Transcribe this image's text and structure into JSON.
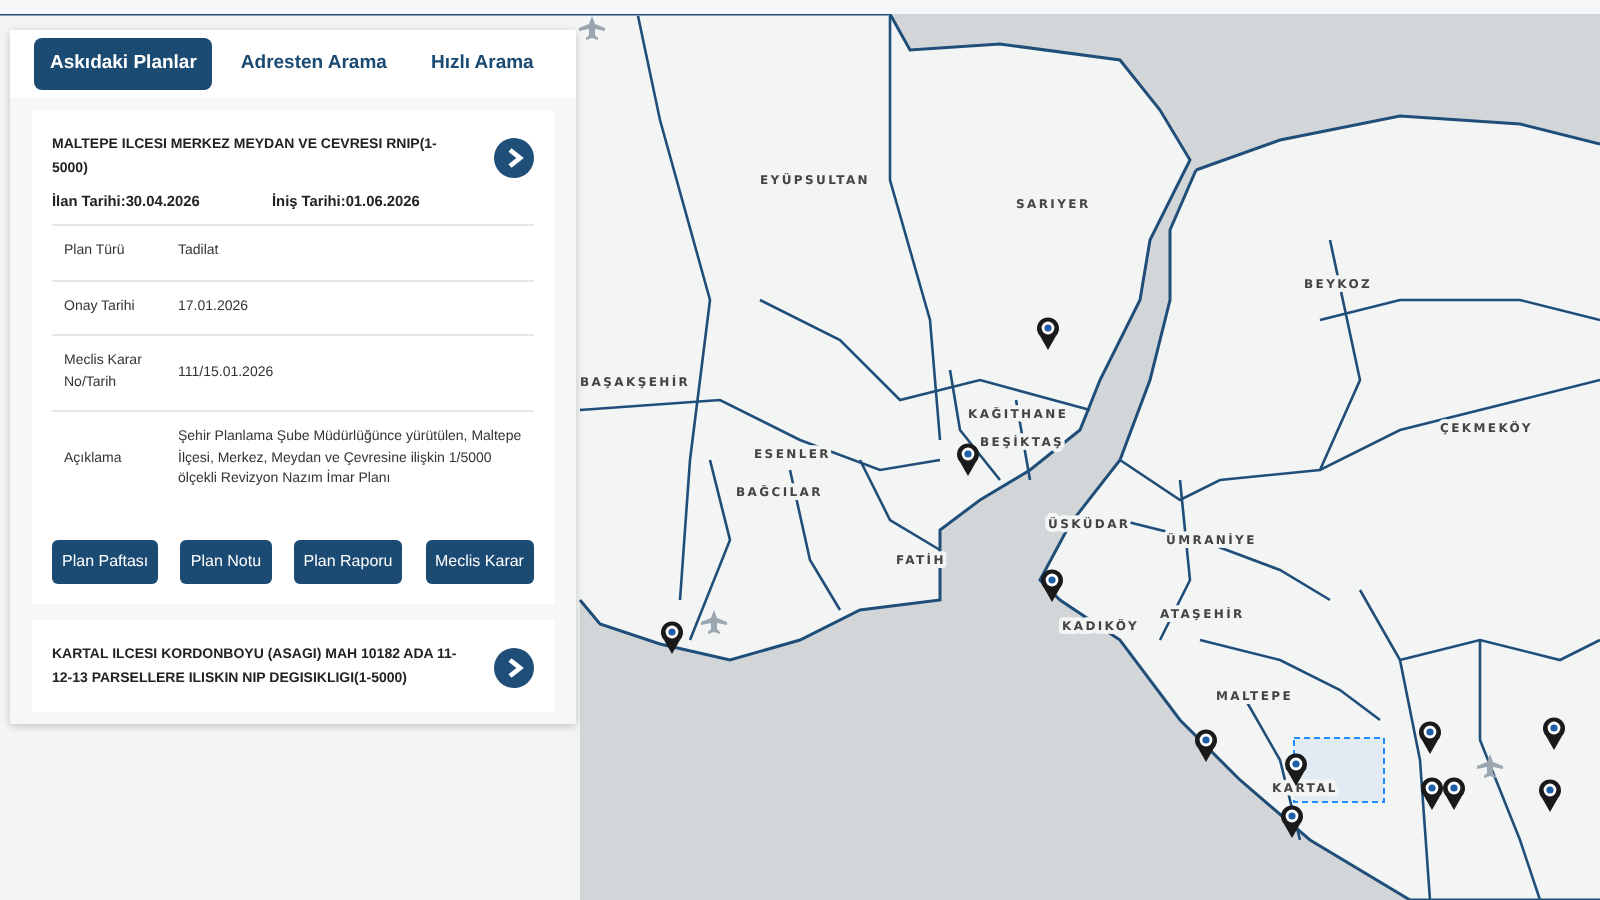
{
  "tabs": [
    {
      "label": "Askıdaki Planlar",
      "selected": true
    },
    {
      "label": "Adresten Arama",
      "selected": false
    },
    {
      "label": "Hızlı Arama",
      "selected": false
    }
  ],
  "plans": [
    {
      "title": "MALTEPE ILCESI MERKEZ MEYDAN VE CEVRESI RNIP(1-5000)",
      "announce_date": "İlan Tarihi:30.04.2026",
      "end_date": "İniş Tarihi:01.06.2026",
      "details": [
        {
          "label": "Plan Türü",
          "value": "Tadilat"
        },
        {
          "label": "Onay Tarihi",
          "value": "17.01.2026"
        },
        {
          "label": "Meclis Karar No/Tarih",
          "value": "111/15.01.2026"
        },
        {
          "label": "Açıklama",
          "value": "Şehir Planlama Şube Müdürlüğünce yürütülen, Maltepe İlçesi, Merkez, Meydan ve Çevresine ilişkin 1/5000 ölçekli Revizyon Nazım İmar Planı"
        }
      ],
      "buttons": [
        "Plan Paftası",
        "Plan Notu",
        "Plan Raporu",
        "Meclis Karar"
      ]
    },
    {
      "title": "KARTAL ILCESI KORDONBOYU (ASAGI) MAH 10182 ADA 11-12-13 PARSELLERE ILISKIN NIP DEGISIKLIGI(1-5000)"
    }
  ],
  "map": {
    "labels": [
      "EYÜPSULTAN",
      "SARIYER",
      "BEYKOZ",
      "BAŞAKŞEHİR",
      "ÇEKMEKÖY",
      "KAĞITHANE",
      "BEŞİKTAŞ",
      "ESENLER",
      "BAĞCILAR",
      "FATİH",
      "ÜSKÜDAR",
      "ÜMRANİYE",
      "KADIKÖY",
      "ATAŞEHİR",
      "MALTEPE",
      "KARTAL"
    ]
  }
}
